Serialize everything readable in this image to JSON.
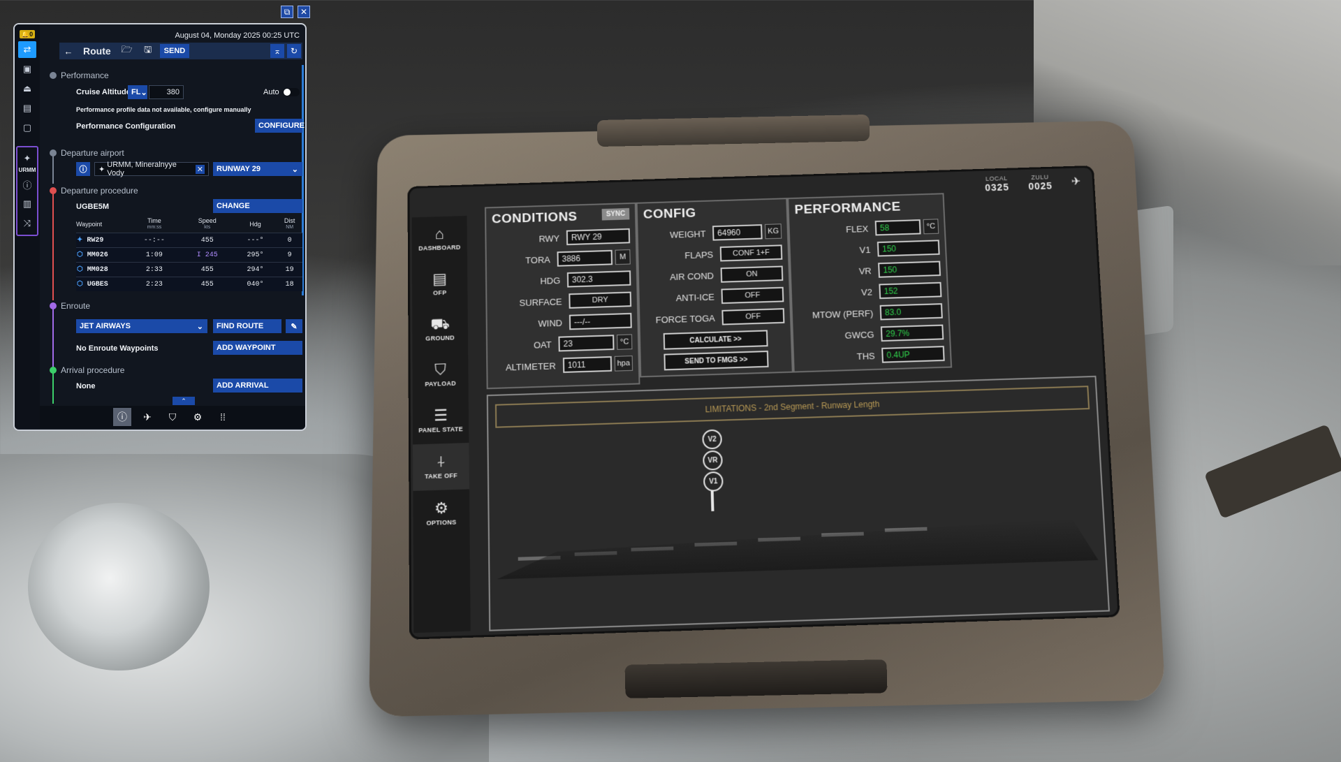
{
  "window_icons": [
    "popout-icon",
    "close-icon"
  ],
  "planner": {
    "date": "August 04, Monday 2025 00:25 UTC",
    "alerts_badge": "0",
    "toolbar": {
      "title": "Route",
      "send_label": "SEND"
    },
    "sidebar": {
      "airport_label": "URMM"
    },
    "performance": {
      "header": "Performance",
      "cruise_label": "Cruise Altitude",
      "cruise_unit": "FL",
      "cruise_value": "380",
      "auto_label": "Auto",
      "warning": "Performance profile data not available, configure manually",
      "config_label": "Performance Configuration",
      "configure_button": "CONFIGURE"
    },
    "departure": {
      "header": "Departure airport",
      "airport": "URMM, Mineralnyye Vody",
      "runway": "RUNWAY 29"
    },
    "procedure": {
      "header": "Departure procedure",
      "name": "UGBE5M",
      "change_button": "CHANGE",
      "columns": [
        {
          "label": "Waypoint",
          "sub": ""
        },
        {
          "label": "Time",
          "sub": "mm:ss"
        },
        {
          "label": "Speed",
          "sub": "kts"
        },
        {
          "label": "Hdg",
          "sub": ""
        },
        {
          "label": "Dist",
          "sub": "NM"
        }
      ],
      "rows": [
        {
          "wp": "RW29",
          "time": "--:--",
          "speed": "455",
          "hdg": "---°",
          "dist": "0"
        },
        {
          "wp": "MM026",
          "time": "1:09",
          "speed": "I 245",
          "hdg": "295°",
          "dist": "9"
        },
        {
          "wp": "MM028",
          "time": "2:33",
          "speed": "455",
          "hdg": "294°",
          "dist": "19"
        },
        {
          "wp": "UGBES",
          "time": "2:23",
          "speed": "455",
          "hdg": "040°",
          "dist": "18"
        }
      ]
    },
    "enroute": {
      "header": "Enroute",
      "airway_select": "JET AIRWAYS",
      "find_route_button": "FIND ROUTE",
      "no_waypoints": "No Enroute Waypoints",
      "add_waypoint_button": "ADD WAYPOINT"
    },
    "arrival": {
      "header": "Arrival procedure",
      "value": "None",
      "add_arrival_button": "ADD ARRIVAL"
    },
    "colors": {
      "accent": "#1b4aa8",
      "highlight": "#1e9bff",
      "departure_dot": "#e05050",
      "enroute_dot": "#a26ae8",
      "arrival_dot": "#3ccf6a"
    }
  },
  "efb": {
    "local_label": "LOCAL",
    "local_time": "0325",
    "zulu_label": "ZULU",
    "zulu_time": "0025",
    "nav": [
      {
        "label": "DASHBOARD",
        "icon": "home-icon",
        "glyph": "⌂"
      },
      {
        "label": "OFP",
        "icon": "clipboard-icon",
        "glyph": "▤"
      },
      {
        "label": "GROUND",
        "icon": "truck-icon",
        "glyph": "⛟"
      },
      {
        "label": "PAYLOAD",
        "icon": "bag-icon",
        "glyph": "⛉"
      },
      {
        "label": "PANEL STATE",
        "icon": "list-icon",
        "glyph": "☰"
      },
      {
        "label": "TAKE OFF",
        "icon": "takeoff-icon",
        "glyph": "⍭"
      },
      {
        "label": "OPTIONS",
        "icon": "gear-icon",
        "glyph": "⚙"
      }
    ],
    "conditions": {
      "title": "CONDITIONS",
      "sync": "SYNC",
      "rwy_label": "RWY",
      "rwy": "RWY 29",
      "tora_label": "TORA",
      "tora": "3886",
      "tora_unit": "M",
      "hdg_label": "HDG",
      "hdg": "302.3",
      "surface_label": "SURFACE",
      "surface": "DRY",
      "wind_label": "WIND",
      "wind": "---/--",
      "oat_label": "OAT",
      "oat": "23",
      "oat_unit": "°C",
      "alt_label": "ALTIMETER",
      "alt": "1011",
      "alt_unit": "hpa"
    },
    "config": {
      "title": "CONFIG",
      "weight_label": "WEIGHT",
      "weight": "64960",
      "weight_unit": "KG",
      "flaps_label": "FLAPS",
      "flaps": "CONF 1+F",
      "aircond_label": "AIR COND",
      "aircond": "ON",
      "antiice_label": "ANTI-ICE",
      "antiice": "OFF",
      "toga_label": "FORCE TOGA",
      "toga": "OFF",
      "calculate": "CALCULATE >>",
      "send": "SEND TO FMGS >>"
    },
    "performance": {
      "title": "PERFORMANCE",
      "flex_label": "FLEX",
      "flex": "58",
      "flex_unit": "°C",
      "v1_label": "V1",
      "v1": "150",
      "vr_label": "VR",
      "vr": "150",
      "v2_label": "V2",
      "v2": "152",
      "mtow_label": "MTOW (PERF)",
      "mtow": "83.0",
      "gwcg_label": "GWCG",
      "gwcg": "29.7%",
      "ths_label": "THS",
      "ths": "0.4UP"
    },
    "limitations": "LIMITATIONS - 2nd Segment - Runway Length",
    "speed_marks": [
      "V2",
      "VR",
      "V1"
    ]
  }
}
